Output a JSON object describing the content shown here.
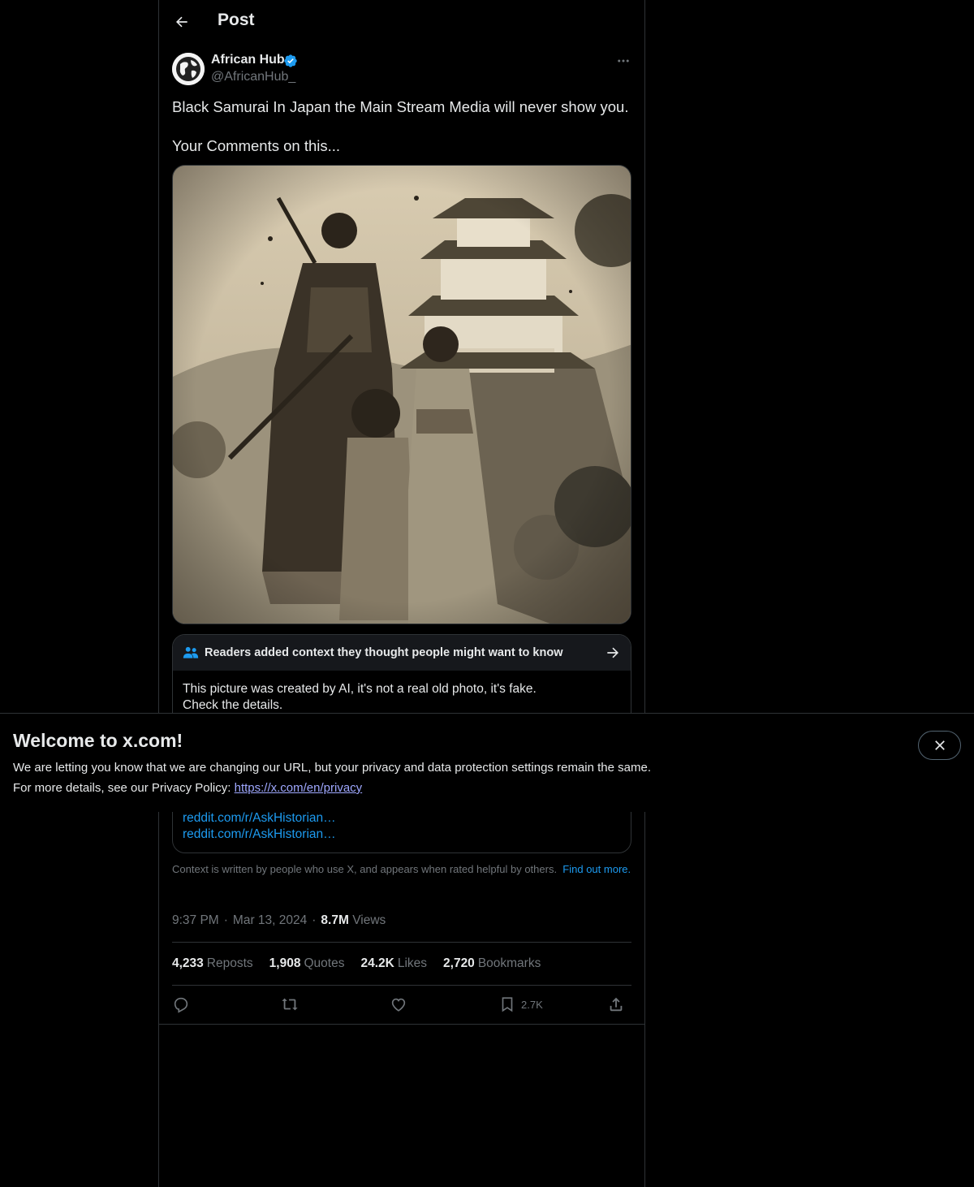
{
  "header": {
    "title": "Post",
    "back_icon": "arrow-left-icon"
  },
  "author": {
    "name": "African Hub",
    "handle": "@AfricanHub_",
    "verified": true,
    "verified_color": "#1d9bf0"
  },
  "post": {
    "lines": [
      "Black Samurai In Japan the Main Stream Media will never show you.",
      "Your Comments on this..."
    ],
    "image_subject": "sepia photo-style image of a samurai family in front of a Japanese castle"
  },
  "note": {
    "title": "Readers added context they thought people might want to know",
    "body_line1": "This picture was created by AI, it's not a real old photo, it's fake.",
    "body_line2": "Check the details.",
    "links": [
      "reddit.com/r/AskHistorian…",
      "reddit.com/r/AskHistorian…"
    ],
    "footer_text": "Context is written by people who use X, and appears when rated helpful by others.",
    "footer_link": "Find out more."
  },
  "meta": {
    "time": "9:37 PM",
    "date": "Mar 13, 2024",
    "views_count": "8.7M",
    "views_label": "Views"
  },
  "stats": [
    {
      "count": "4,233",
      "label": "Reposts"
    },
    {
      "count": "1,908",
      "label": "Quotes"
    },
    {
      "count": "24.2K",
      "label": "Likes"
    },
    {
      "count": "2,720",
      "label": "Bookmarks"
    }
  ],
  "actions": {
    "bookmark_count": "2.7K"
  },
  "banner": {
    "title": "Welcome to x.com!",
    "line1": "We are letting you know that we are changing our URL, but your privacy and data protection settings remain the same.",
    "line2_prefix": "For more details, see our Privacy Policy:",
    "link": "https://x.com/en/privacy"
  },
  "colors": {
    "background": "#000000",
    "text": "#e7e9ea",
    "muted": "#71767b",
    "accent": "#1d9bf0",
    "border": "#2f3336"
  }
}
